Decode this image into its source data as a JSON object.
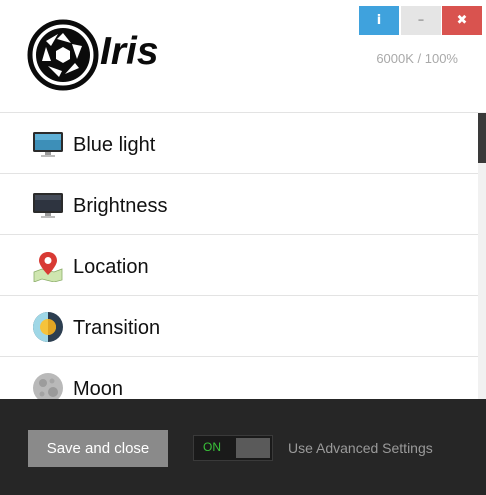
{
  "app": {
    "name": "Iris",
    "status": "6000K / 100%"
  },
  "window_controls": {
    "info": "i",
    "minimize": "–",
    "close": "✖"
  },
  "menu": {
    "items": [
      {
        "label": "Blue light",
        "icon": "monitor-icon"
      },
      {
        "label": "Brightness",
        "icon": "monitor-dark-icon"
      },
      {
        "label": "Location",
        "icon": "map-pin-icon"
      },
      {
        "label": "Transition",
        "icon": "sun-clock-icon"
      },
      {
        "label": "Moon",
        "icon": "moon-icon"
      }
    ]
  },
  "footer": {
    "save_label": "Save and close",
    "toggle_label": "ON",
    "toggle_state": "on",
    "advanced_label": "Use Advanced Settings"
  },
  "colors": {
    "info": "#3fa2dd",
    "close": "#d9534f",
    "footer": "#262626",
    "toggle_on": "#39c239"
  }
}
